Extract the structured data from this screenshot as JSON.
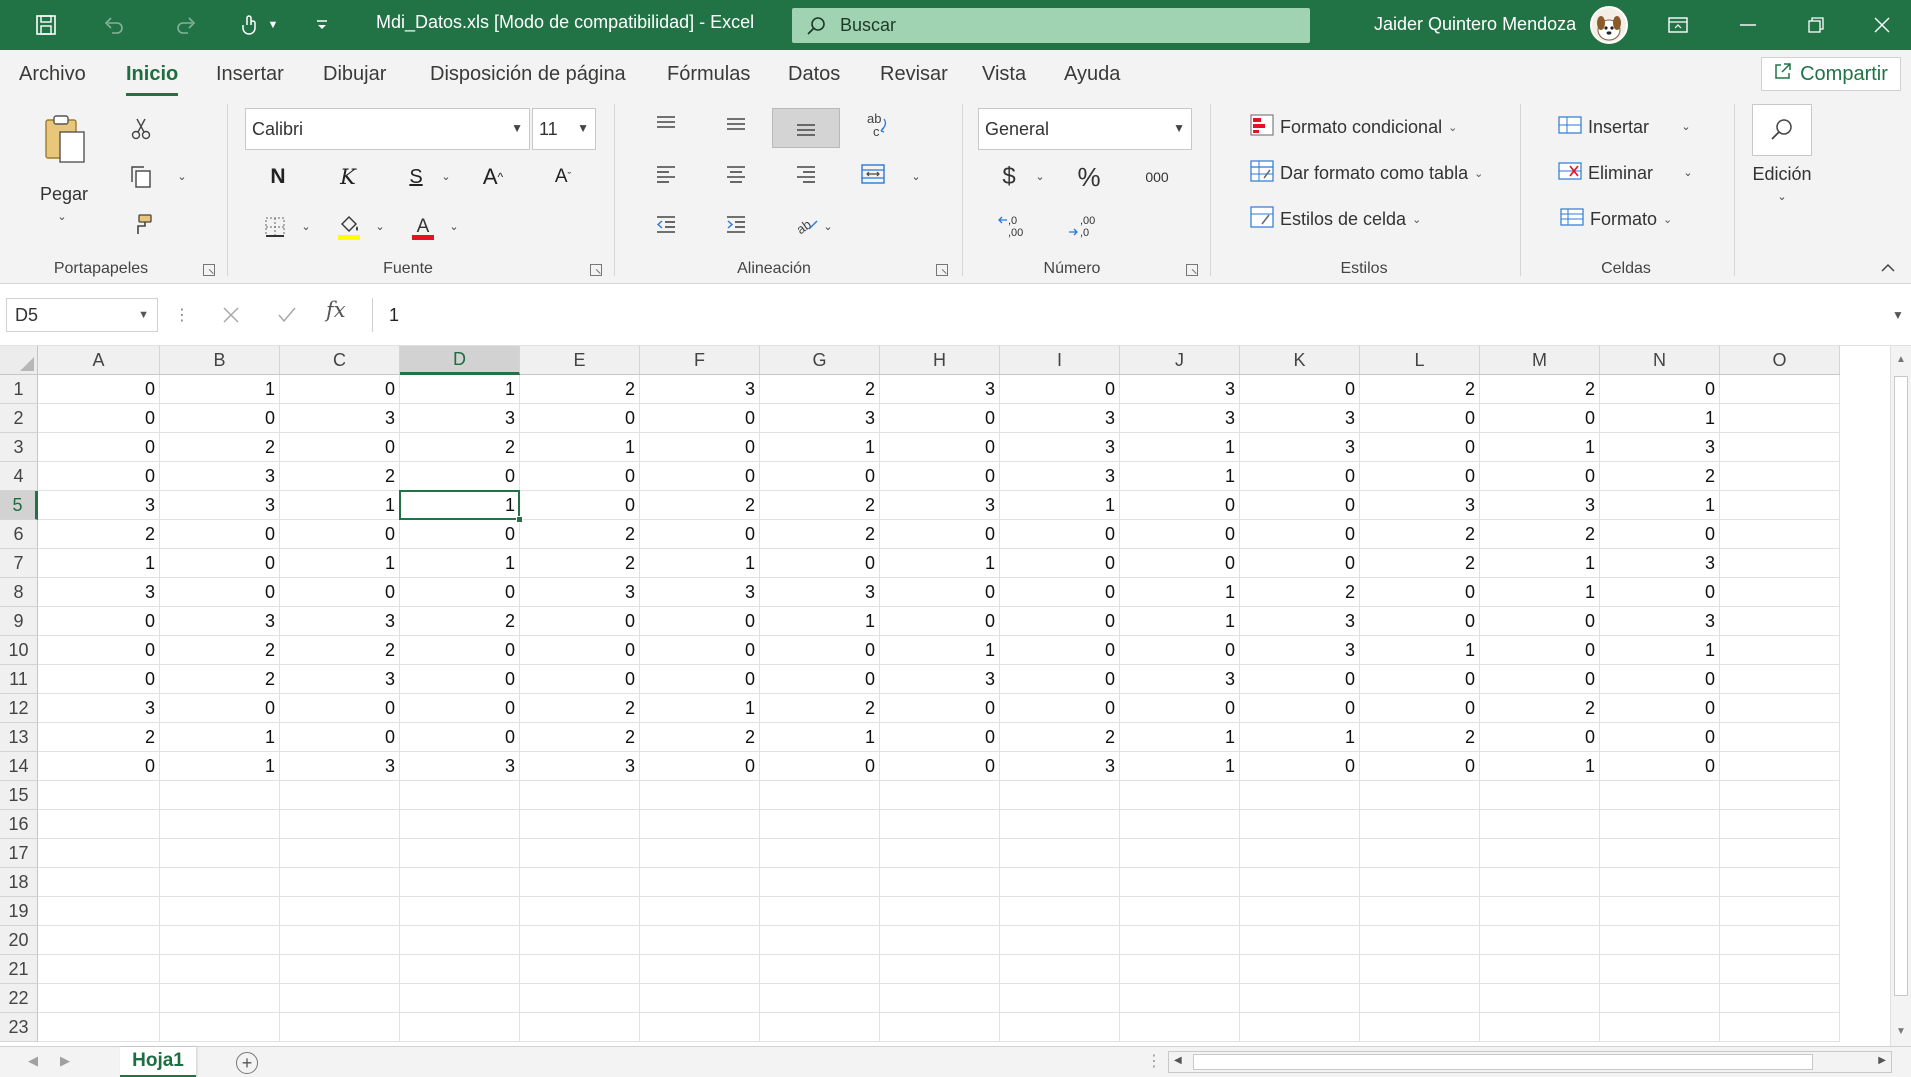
{
  "window": {
    "title": "Mdi_Datos.xls  [Modo de compatibilidad]  -  Excel",
    "search_placeholder": "Buscar",
    "user_name": "Jaider Quintero Mendoza"
  },
  "menu": {
    "tabs": [
      "Archivo",
      "Inicio",
      "Insertar",
      "Dibujar",
      "Disposición de página",
      "Fórmulas",
      "Datos",
      "Revisar",
      "Vista",
      "Ayuda"
    ],
    "active_tab": "Inicio",
    "share_label": "Compartir"
  },
  "ribbon": {
    "clipboard": {
      "paste_label": "Pegar",
      "group_label": "Portapapeles"
    },
    "font": {
      "font_name": "Calibri",
      "font_size": "11",
      "bold_label": "N",
      "italic_label": "K",
      "underline_label": "S",
      "group_label": "Fuente"
    },
    "alignment": {
      "group_label": "Alineación"
    },
    "number": {
      "format": "General",
      "currency_symbol": "$",
      "percent_symbol": "%",
      "thousands_label": "000",
      "group_label": "Número"
    },
    "styles": {
      "conditional_format": "Formato condicional",
      "format_as_table": "Dar formato como tabla",
      "cell_styles": "Estilos de celda",
      "group_label": "Estilos"
    },
    "cells": {
      "insert": "Insertar",
      "delete": "Eliminar",
      "format": "Formato",
      "group_label": "Celdas"
    },
    "editing": {
      "label": "Edición"
    }
  },
  "formula_bar": {
    "name_box": "D5",
    "fx_label": "fx",
    "formula": "1"
  },
  "sheet": {
    "columns": [
      "A",
      "B",
      "C",
      "D",
      "E",
      "F",
      "G",
      "H",
      "I",
      "J",
      "K",
      "L",
      "M",
      "N",
      "O"
    ],
    "row_count": 23,
    "selected_cell": {
      "col": "D",
      "row": 5
    },
    "data": [
      [
        0,
        1,
        0,
        1,
        2,
        3,
        2,
        3,
        0,
        3,
        0,
        2,
        2,
        0
      ],
      [
        0,
        0,
        3,
        3,
        0,
        0,
        3,
        0,
        3,
        3,
        3,
        0,
        0,
        1
      ],
      [
        0,
        2,
        0,
        2,
        1,
        0,
        1,
        0,
        3,
        1,
        3,
        0,
        1,
        3
      ],
      [
        0,
        3,
        2,
        0,
        0,
        0,
        0,
        0,
        3,
        1,
        0,
        0,
        0,
        2
      ],
      [
        3,
        3,
        1,
        1,
        0,
        2,
        2,
        3,
        1,
        0,
        0,
        3,
        3,
        1
      ],
      [
        2,
        0,
        0,
        0,
        2,
        0,
        2,
        0,
        0,
        0,
        0,
        2,
        2,
        0
      ],
      [
        1,
        0,
        1,
        1,
        2,
        1,
        0,
        1,
        0,
        0,
        0,
        2,
        1,
        3
      ],
      [
        3,
        0,
        0,
        0,
        3,
        3,
        3,
        0,
        0,
        1,
        2,
        0,
        1,
        0
      ],
      [
        0,
        3,
        3,
        2,
        0,
        0,
        1,
        0,
        0,
        1,
        3,
        0,
        0,
        3
      ],
      [
        0,
        2,
        2,
        0,
        0,
        0,
        0,
        1,
        0,
        0,
        3,
        1,
        0,
        1
      ],
      [
        0,
        2,
        3,
        0,
        0,
        0,
        0,
        3,
        0,
        3,
        0,
        0,
        0,
        0
      ],
      [
        3,
        0,
        0,
        0,
        2,
        1,
        2,
        0,
        0,
        0,
        0,
        0,
        2,
        0
      ],
      [
        2,
        1,
        0,
        0,
        2,
        2,
        1,
        0,
        2,
        1,
        1,
        2,
        0,
        0
      ],
      [
        0,
        1,
        3,
        3,
        3,
        0,
        0,
        0,
        3,
        1,
        0,
        0,
        1,
        0
      ]
    ]
  },
  "sheet_tabs": {
    "active": "Hoja1"
  },
  "colors": {
    "accent": "#217346",
    "search_bg": "#9fd3b1"
  }
}
